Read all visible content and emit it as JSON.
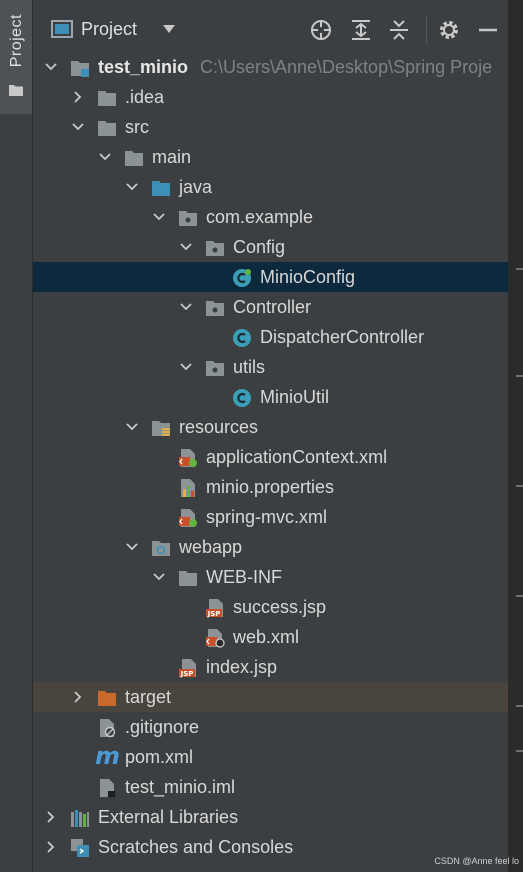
{
  "sidebar": {
    "tab_label": "Project"
  },
  "header": {
    "title": "Project"
  },
  "tree": {
    "project_name": "test_minio",
    "project_path": "C:\\Users\\Anne\\Desktop\\Spring Proje",
    "idea": ".idea",
    "src": "src",
    "main": "main",
    "java": "java",
    "package": "com.example",
    "config_folder": "Config",
    "minio_config": "MinioConfig",
    "controller_folder": "Controller",
    "dispatcher_controller": "DispatcherController",
    "utils_folder": "utils",
    "minio_util": "MinioUtil",
    "resources": "resources",
    "application_context": "applicationContext.xml",
    "minio_properties": "minio.properties",
    "spring_mvc": "spring-mvc.xml",
    "webapp": "webapp",
    "web_inf": "WEB-INF",
    "success_jsp": "success.jsp",
    "web_xml": "web.xml",
    "index_jsp": "index.jsp",
    "target": "target",
    "gitignore": ".gitignore",
    "pom": "pom.xml",
    "iml": "test_minio.iml",
    "external_libraries": "External Libraries",
    "scratches": "Scratches and Consoles"
  },
  "icon_text": {
    "jsp": "JSP",
    "maven": "m"
  },
  "watermark": "CSDN @Anne feel lo",
  "colors": {
    "panel_bg": "#3c3f41",
    "selected_row": "#0d293e",
    "excluded_row": "#49443d",
    "folder": "#8b9396",
    "source_folder": "#3d8fb5",
    "excluded_folder": "#c96a2b",
    "class_icon": "#3a9fb6"
  }
}
